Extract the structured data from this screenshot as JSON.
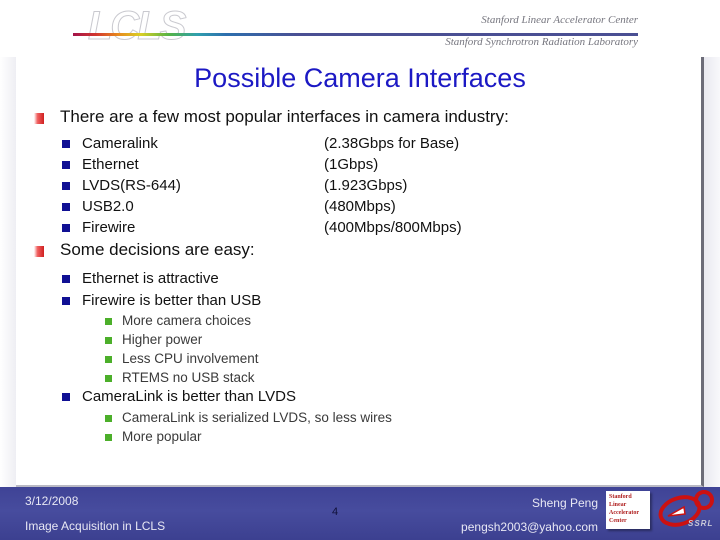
{
  "banner": {
    "logo_text": "LCLS",
    "line1": "Stanford Linear Accelerator Center",
    "line2": "Stanford Synchrotron Radiation Laboratory"
  },
  "slide": {
    "title": "Possible Camera Interfaces",
    "sections": [
      {
        "heading": "There are a few most popular interfaces in camera industry:",
        "interfaces": [
          {
            "name": "Cameralink",
            "spec": "(2.38Gbps for Base)"
          },
          {
            "name": "Ethernet",
            "spec": "(1Gbps)"
          },
          {
            "name": "LVDS(RS-644)",
            "spec": "(1.923Gbps)"
          },
          {
            "name": "USB2.0",
            "spec": "(480Mbps)"
          },
          {
            "name": "Firewire",
            "spec": "(400Mbps/800Mbps)"
          }
        ]
      },
      {
        "heading": "Some decisions are easy:",
        "decisions": [
          {
            "text": "Ethernet is attractive",
            "reasons": []
          },
          {
            "text": "Firewire is better than USB",
            "reasons": [
              "More camera choices",
              "Higher power",
              "Less CPU involvement",
              "RTEMS no USB stack"
            ]
          },
          {
            "text": "CameraLink is better than LVDS",
            "reasons": [
              "CameraLink is serialized LVDS, so less wires",
              "More popular"
            ]
          }
        ]
      }
    ]
  },
  "footer": {
    "date": "3/12/2008",
    "subject": "Image Acquisition in LCLS",
    "page_number": "4",
    "author": "Sheng Peng",
    "email": "pengsh2003@yahoo.com",
    "slac_logo_lines": [
      "Stanford",
      "Linear",
      "Accelerator",
      "Center"
    ],
    "ssrl_logo_text": "SSRL"
  },
  "colors": {
    "title_blue": "#1c19c4",
    "footer_blue": "#474c9e",
    "bullet_red": "#cf2020",
    "bullet_navy": "#101094",
    "bullet_green": "#4caf2a"
  }
}
